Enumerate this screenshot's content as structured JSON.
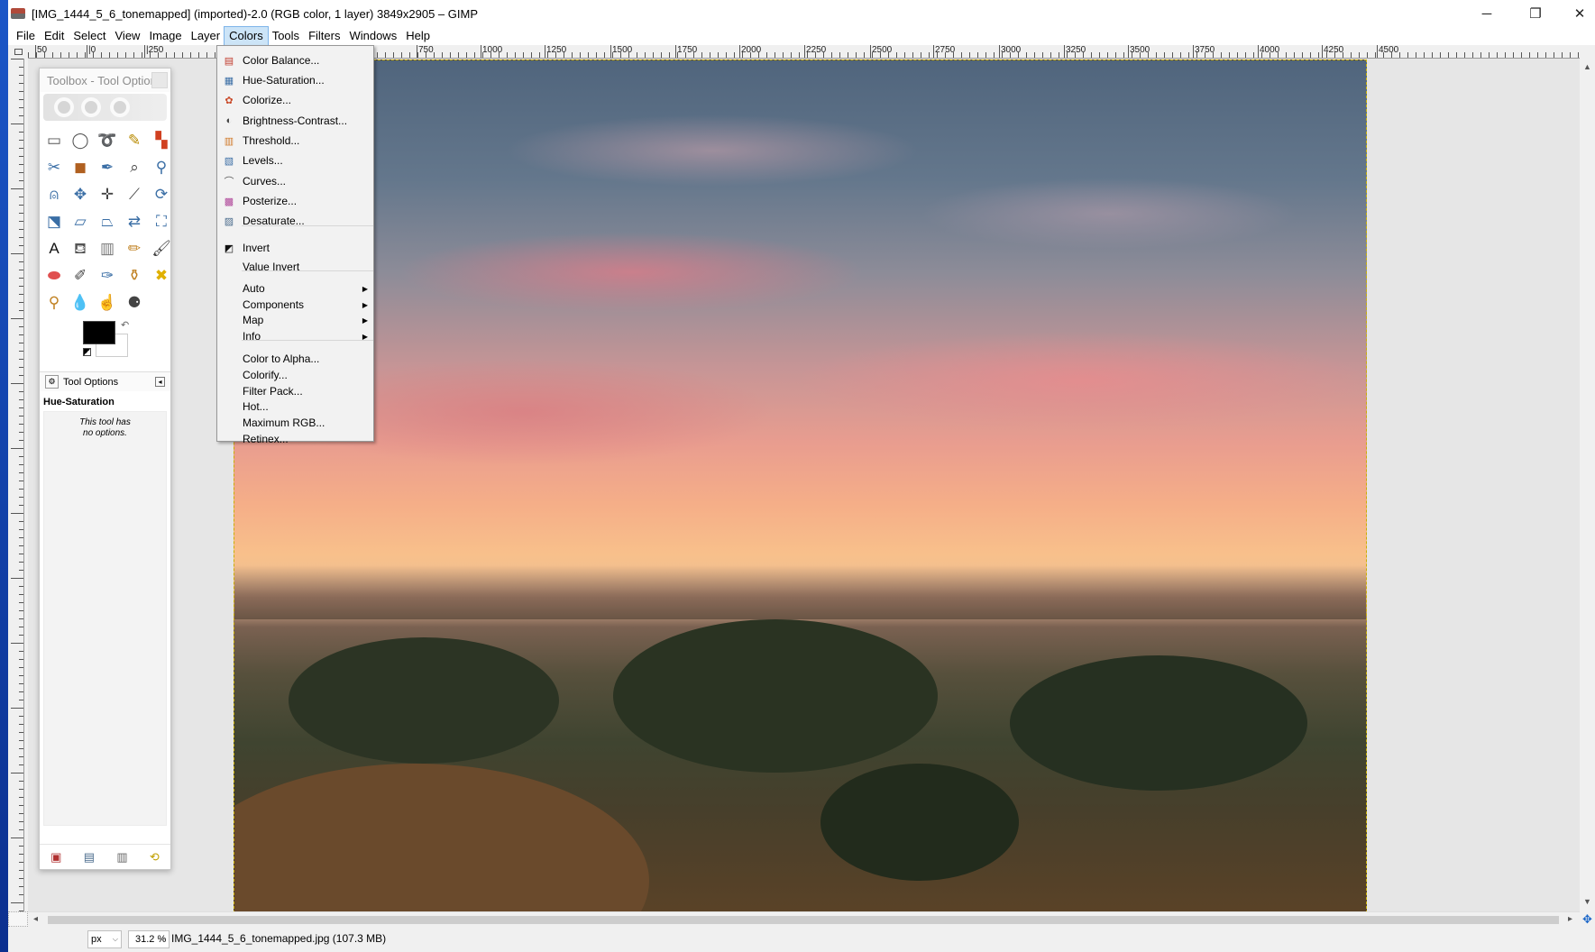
{
  "window": {
    "title": "[IMG_1444_5_6_tonemapped] (imported)-2.0 (RGB color, 1 layer) 3849x2905 – GIMP",
    "controls": {
      "minimize": "─",
      "maximize": "❐",
      "close": "✕"
    }
  },
  "menubar": {
    "items": [
      "File",
      "Edit",
      "Select",
      "View",
      "Image",
      "Layer",
      "Colors",
      "Tools",
      "Filters",
      "Windows",
      "Help"
    ],
    "active": "Colors"
  },
  "ruler": {
    "labels": [
      "50",
      "|0",
      "|250",
      "750",
      "1000",
      "1250",
      "1500",
      "1750",
      "2000",
      "2250",
      "2500",
      "2750",
      "3000",
      "3250",
      "3500",
      "3750",
      "4000",
      "4250",
      "4500"
    ]
  },
  "colors_menu": {
    "items": [
      {
        "label": "Color Balance...",
        "icon": "color-balance-icon",
        "glyph": "▤",
        "color": "#c0392b"
      },
      {
        "label": "Hue-Saturation...",
        "icon": "hue-saturation-icon",
        "glyph": "▦",
        "color": "#3b6ea5"
      },
      {
        "label": "Colorize...",
        "icon": "colorize-icon",
        "glyph": "✿",
        "color": "#c94b2b"
      },
      {
        "label": "Brightness-Contrast...",
        "icon": "brightness-contrast-icon",
        "glyph": "◐",
        "color": "#444444"
      },
      {
        "label": "Threshold...",
        "icon": "threshold-icon",
        "glyph": "▥",
        "color": "#d07a2a"
      },
      {
        "label": "Levels...",
        "icon": "levels-icon",
        "glyph": "▧",
        "color": "#3b6ea5"
      },
      {
        "label": "Curves...",
        "icon": "curves-icon",
        "glyph": "⌒",
        "color": "#555555"
      },
      {
        "label": "Posterize...",
        "icon": "posterize-icon",
        "glyph": "▩",
        "color": "#b0479a"
      },
      {
        "label": "Desaturate...",
        "icon": "desaturate-icon",
        "glyph": "▨",
        "color": "#4a6b8c"
      },
      {
        "label": "Invert",
        "icon": "invert-icon",
        "glyph": "◩",
        "color": "#111111"
      },
      {
        "label": "Value Invert",
        "icon": "",
        "glyph": "",
        "color": ""
      },
      {
        "label": "Auto",
        "submenu": true
      },
      {
        "label": "Components",
        "submenu": true
      },
      {
        "label": "Map",
        "submenu": true
      },
      {
        "label": "Info",
        "submenu": true
      },
      {
        "label": "Color to Alpha..."
      },
      {
        "label": "Colorify..."
      },
      {
        "label": "Filter Pack..."
      },
      {
        "label": "Hot..."
      },
      {
        "label": "Maximum RGB..."
      },
      {
        "label": "Retinex..."
      }
    ]
  },
  "toolbox": {
    "title": "Toolbox - Tool Options",
    "tools": [
      {
        "name": "rect-select-icon",
        "glyph": "▭",
        "color": "#555"
      },
      {
        "name": "ellipse-select-icon",
        "glyph": "◯",
        "color": "#555"
      },
      {
        "name": "free-select-icon",
        "glyph": "➰",
        "color": "#555"
      },
      {
        "name": "fuzzy-select-icon",
        "glyph": "✎",
        "color": "#b88a00"
      },
      {
        "name": "select-by-color-icon",
        "glyph": "▚",
        "color": "#d04020"
      },
      {
        "name": "scissors-select-icon",
        "glyph": "✂",
        "color": "#3a6ea5"
      },
      {
        "name": "foreground-select-icon",
        "glyph": "◼",
        "color": "#b06020"
      },
      {
        "name": "paths-icon",
        "glyph": "✒",
        "color": "#3a6ea5"
      },
      {
        "name": "color-picker-icon",
        "glyph": "⌕",
        "color": "#444"
      },
      {
        "name": "zoom-icon",
        "glyph": "⚲",
        "color": "#3a6ea5"
      },
      {
        "name": "measure-icon",
        "glyph": "⍝",
        "color": "#3a6ea5"
      },
      {
        "name": "move-icon",
        "glyph": "✥",
        "color": "#3a6ea5"
      },
      {
        "name": "align-icon",
        "glyph": "✛",
        "color": "#444"
      },
      {
        "name": "crop-icon",
        "glyph": "⟋",
        "color": "#444"
      },
      {
        "name": "rotate-icon",
        "glyph": "⟳",
        "color": "#3a6ea5"
      },
      {
        "name": "scale-icon",
        "glyph": "⬔",
        "color": "#3a6ea5"
      },
      {
        "name": "shear-icon",
        "glyph": "▱",
        "color": "#3a6ea5"
      },
      {
        "name": "perspective-icon",
        "glyph": "⏢",
        "color": "#3a6ea5"
      },
      {
        "name": "flip-icon",
        "glyph": "⇄",
        "color": "#3a6ea5"
      },
      {
        "name": "cage-transform-icon",
        "glyph": "⛶",
        "color": "#3a6ea5"
      },
      {
        "name": "text-icon",
        "glyph": "A",
        "color": "#111"
      },
      {
        "name": "bucket-fill-icon",
        "glyph": "⛾",
        "color": "#555"
      },
      {
        "name": "blend-icon",
        "glyph": "▥",
        "color": "#777"
      },
      {
        "name": "pencil-icon",
        "glyph": "✏",
        "color": "#c08020"
      },
      {
        "name": "paintbrush-icon",
        "glyph": "🖌",
        "color": "#444"
      },
      {
        "name": "eraser-icon",
        "glyph": "⬬",
        "color": "#e05050"
      },
      {
        "name": "airbrush-icon",
        "glyph": "✐",
        "color": "#444"
      },
      {
        "name": "ink-icon",
        "glyph": "✑",
        "color": "#3a6ea5"
      },
      {
        "name": "clone-icon",
        "glyph": "⚱",
        "color": "#c08020"
      },
      {
        "name": "heal-icon",
        "glyph": "✖",
        "color": "#e0b000"
      },
      {
        "name": "perspective-clone-icon",
        "glyph": "⚲",
        "color": "#c08020"
      },
      {
        "name": "blur-icon",
        "glyph": "💧",
        "color": "#3a6ea5"
      },
      {
        "name": "smudge-icon",
        "glyph": "☝",
        "color": "#c08020"
      },
      {
        "name": "dodge-burn-icon",
        "glyph": "⚈",
        "color": "#444"
      }
    ],
    "swap_glyph": "↶",
    "tool_options_tab": "Tool Options",
    "tool_name": "Hue-Saturation",
    "note_line1": "This tool has",
    "note_line2": "no options.",
    "footer_icons": [
      "save-options-icon",
      "restore-options-icon",
      "delete-options-icon",
      "reset-options-icon"
    ]
  },
  "statusbar": {
    "unit": "px",
    "zoom": "31.2 %",
    "file_info": "IMG_1444_5_6_tonemapped.jpg (107.3 MB)"
  }
}
